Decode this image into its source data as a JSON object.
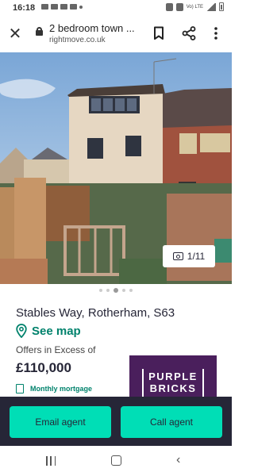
{
  "status_bar": {
    "time": "16:18",
    "network_label": "Vo) LTE"
  },
  "browser": {
    "page_title": "2 bedroom town ...",
    "url": "rightmove.co.uk"
  },
  "gallery": {
    "counter": "1/11",
    "total_dots": 5,
    "active_dot": 2
  },
  "listing": {
    "address": "Stables Way, Rotherham, S63",
    "map_link": "See map",
    "price_qualifier": "Offers in Excess of",
    "price": "£110,000",
    "mortgage_link": "Monthly mortgage"
  },
  "agent": {
    "logo_line1": "PURPLE",
    "logo_line2": "BRICKS",
    "brand_color": "#4a1f5c"
  },
  "actions": {
    "email_label": "Email agent",
    "call_label": "Call agent"
  },
  "colors": {
    "accent": "#00deb6",
    "link": "#00826c",
    "dark": "#262637"
  },
  "icons": {
    "close": "close-icon",
    "lock": "lock-icon",
    "bookmark": "bookmark-icon",
    "share": "share-icon",
    "menu": "more-vert-icon",
    "camera": "camera-icon",
    "pin": "map-pin-icon",
    "calculator": "calculator-icon"
  }
}
